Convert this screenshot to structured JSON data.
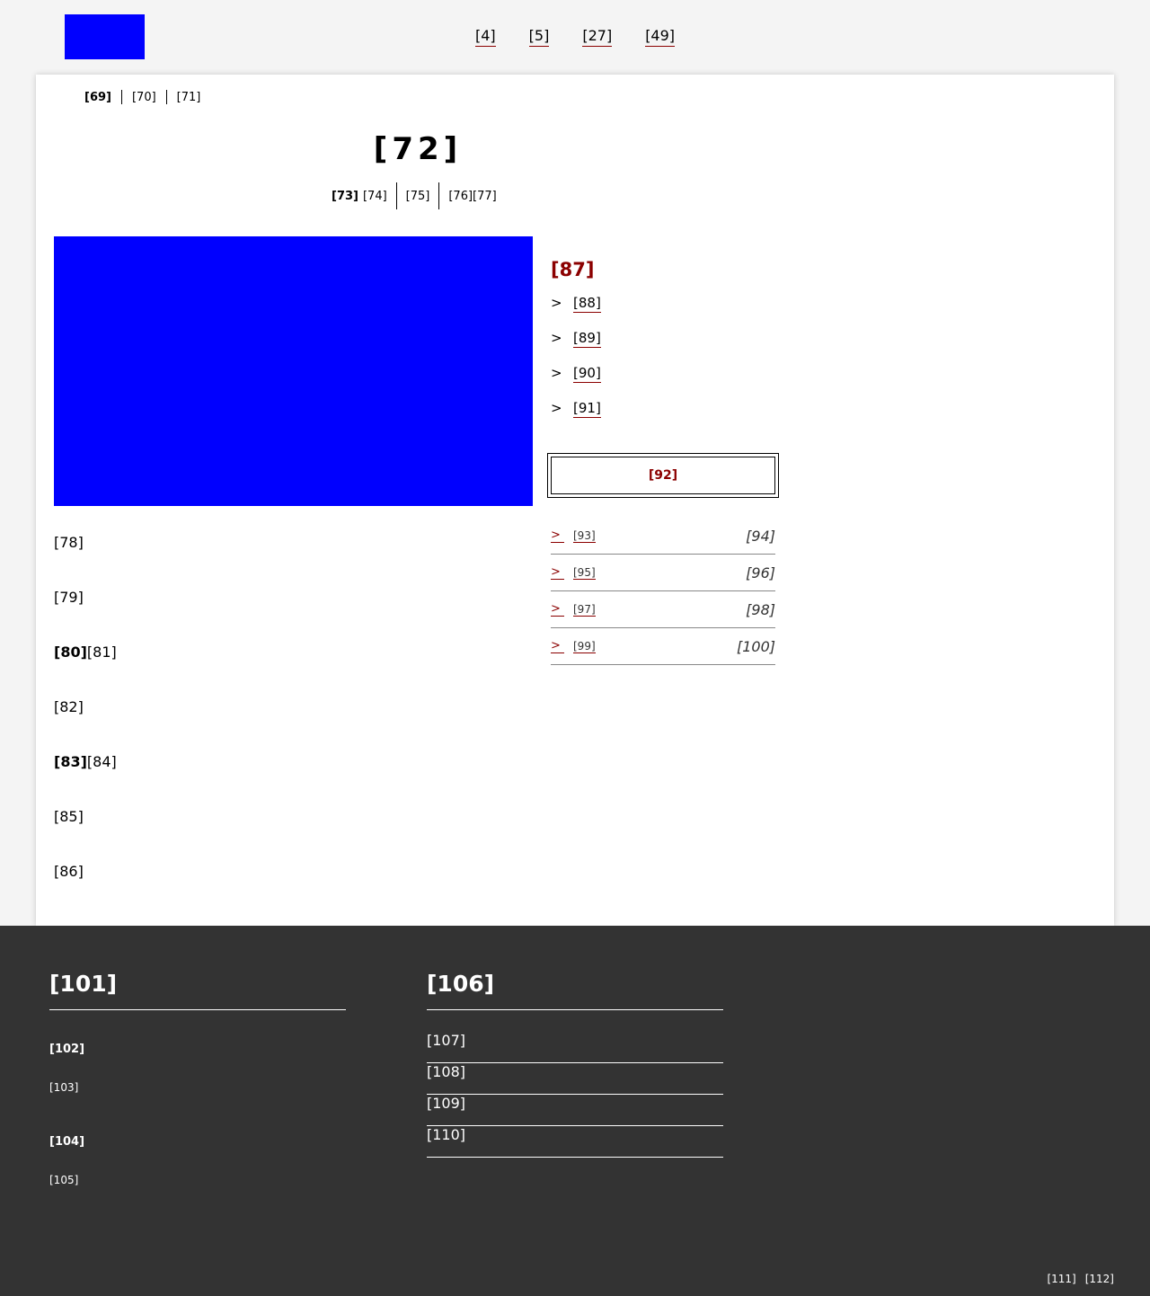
{
  "nav": {
    "links": [
      "[4]",
      "[5]",
      "[27]",
      "[49]"
    ]
  },
  "breadcrumb": {
    "items": [
      "[69]",
      "[70]",
      "[71]"
    ]
  },
  "page": {
    "title": "[72]"
  },
  "meta": {
    "bold": "[73]",
    "items": [
      "[74]",
      "[75]",
      "[76][77]"
    ]
  },
  "body": {
    "lines": [
      {
        "bold": "",
        "text": "[78]"
      },
      {
        "bold": "",
        "text": "[79]"
      },
      {
        "bold": "[80]",
        "text": "[81]"
      },
      {
        "bold": "",
        "text": "[82]"
      },
      {
        "bold": "[83]",
        "text": "[84]"
      },
      {
        "bold": "",
        "text": "[85]"
      },
      {
        "bold": "",
        "text": "[86]"
      }
    ]
  },
  "sidebar": {
    "heading": "[87]",
    "arrow": ">",
    "links": [
      "[88]",
      "[89]",
      "[90]",
      "[91]"
    ],
    "button": "[92]",
    "table": [
      {
        "link": "[93]",
        "value": "[94]"
      },
      {
        "link": "[95]",
        "value": "[96]"
      },
      {
        "link": "[97]",
        "value": "[98]"
      },
      {
        "link": "[99]",
        "value": "[100]"
      }
    ]
  },
  "footer": {
    "col1": {
      "heading": "[101]",
      "groups": [
        {
          "title": "[102]",
          "text": "[103]"
        },
        {
          "title": "[104]",
          "text": "[105]"
        }
      ]
    },
    "col2": {
      "heading": "[106]",
      "links": [
        "[107]",
        "[108]",
        "[109]",
        "[110]"
      ]
    },
    "bottom_links": [
      "[111]",
      "[112]"
    ]
  },
  "colors": {
    "accent": "#8b0000",
    "placeholder_image": "#0000ff",
    "footer_bg": "#333333",
    "page_bg": "#f4f4f4"
  }
}
